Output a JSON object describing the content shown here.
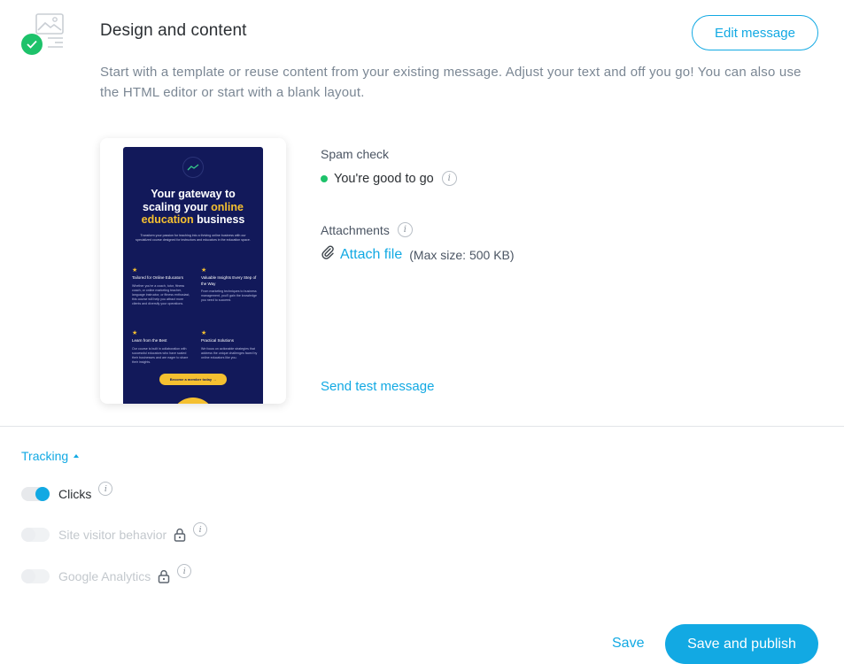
{
  "section": {
    "title": "Design and content",
    "description": "Start with a template or reuse content from your existing message. Adjust your text and off you go! You can also use the HTML editor or start with a blank layout.",
    "edit_button": "Edit message",
    "status_icon": "check-icon",
    "status_color": "#1dc26a"
  },
  "preview": {
    "headline_pre": "Your gateway to scaling your ",
    "headline_highlight": "online education",
    "headline_post": " business",
    "intro": "Transform your passion for teaching into a thriving online business with our specialized course designed for instructors and educators in the education space.",
    "features": [
      {
        "title": "Tailored for Online Educators",
        "body": "Whether you're a coach, tutor, fitness coach, or online marketing teacher, language instructor, or fitness enthusiast, this course will help you attract more clients and diversify your operations."
      },
      {
        "title": "Valuable Insights Every Step of the Way",
        "body": "From marketing techniques to business management, you'll gain the knowledge you need to succeed."
      },
      {
        "title": "Learn from the Best",
        "body": "Our course is built in collaboration with successful educators who have scaled their businesses and are eager to share their insights."
      },
      {
        "title": "Practical Solutions",
        "body": "We focus on actionable strategies that address the unique challenges faced by online educators like you."
      }
    ],
    "cta": "Become a member today →",
    "brand_color": "#12195a",
    "accent_color": "#f5c030"
  },
  "spam_check": {
    "label": "Spam check",
    "status": "You're good to go",
    "status_color": "#1dc26a"
  },
  "attachments": {
    "label": "Attachments",
    "link": "Attach file",
    "limit": "(Max size: 500 KB)",
    "icon": "paperclip-icon"
  },
  "send_test": "Send test message",
  "tracking": {
    "toggle_label": "Tracking",
    "options": [
      {
        "label": "Clicks",
        "enabled": true,
        "locked": false
      },
      {
        "label": "Site visitor behavior",
        "enabled": false,
        "locked": true
      },
      {
        "label": "Google Analytics",
        "enabled": false,
        "locked": true
      }
    ]
  },
  "footer": {
    "save": "Save",
    "save_publish": "Save and publish"
  },
  "colors": {
    "accent": "#12a9e3",
    "divider": "#e2e5e9"
  }
}
